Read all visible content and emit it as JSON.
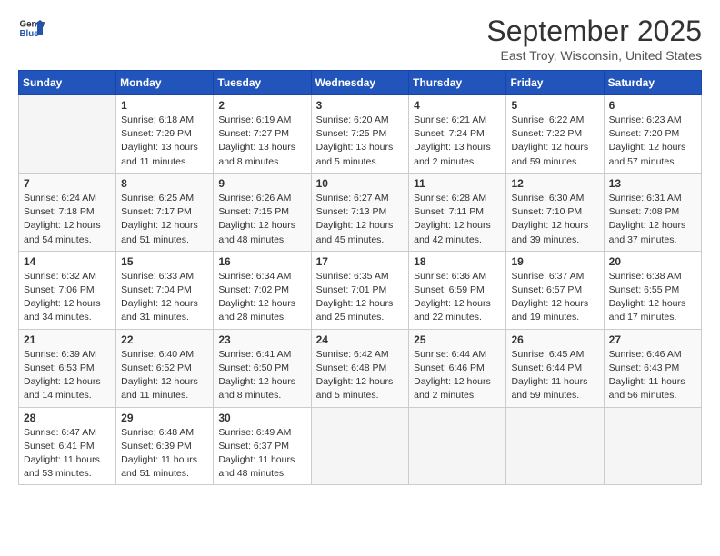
{
  "header": {
    "logo_general": "General",
    "logo_blue": "Blue",
    "month_title": "September 2025",
    "location": "East Troy, Wisconsin, United States"
  },
  "days_of_week": [
    "Sunday",
    "Monday",
    "Tuesday",
    "Wednesday",
    "Thursday",
    "Friday",
    "Saturday"
  ],
  "weeks": [
    [
      {
        "day": "",
        "info": ""
      },
      {
        "day": "1",
        "info": "Sunrise: 6:18 AM\nSunset: 7:29 PM\nDaylight: 13 hours\nand 11 minutes."
      },
      {
        "day": "2",
        "info": "Sunrise: 6:19 AM\nSunset: 7:27 PM\nDaylight: 13 hours\nand 8 minutes."
      },
      {
        "day": "3",
        "info": "Sunrise: 6:20 AM\nSunset: 7:25 PM\nDaylight: 13 hours\nand 5 minutes."
      },
      {
        "day": "4",
        "info": "Sunrise: 6:21 AM\nSunset: 7:24 PM\nDaylight: 13 hours\nand 2 minutes."
      },
      {
        "day": "5",
        "info": "Sunrise: 6:22 AM\nSunset: 7:22 PM\nDaylight: 12 hours\nand 59 minutes."
      },
      {
        "day": "6",
        "info": "Sunrise: 6:23 AM\nSunset: 7:20 PM\nDaylight: 12 hours\nand 57 minutes."
      }
    ],
    [
      {
        "day": "7",
        "info": "Sunrise: 6:24 AM\nSunset: 7:18 PM\nDaylight: 12 hours\nand 54 minutes."
      },
      {
        "day": "8",
        "info": "Sunrise: 6:25 AM\nSunset: 7:17 PM\nDaylight: 12 hours\nand 51 minutes."
      },
      {
        "day": "9",
        "info": "Sunrise: 6:26 AM\nSunset: 7:15 PM\nDaylight: 12 hours\nand 48 minutes."
      },
      {
        "day": "10",
        "info": "Sunrise: 6:27 AM\nSunset: 7:13 PM\nDaylight: 12 hours\nand 45 minutes."
      },
      {
        "day": "11",
        "info": "Sunrise: 6:28 AM\nSunset: 7:11 PM\nDaylight: 12 hours\nand 42 minutes."
      },
      {
        "day": "12",
        "info": "Sunrise: 6:30 AM\nSunset: 7:10 PM\nDaylight: 12 hours\nand 39 minutes."
      },
      {
        "day": "13",
        "info": "Sunrise: 6:31 AM\nSunset: 7:08 PM\nDaylight: 12 hours\nand 37 minutes."
      }
    ],
    [
      {
        "day": "14",
        "info": "Sunrise: 6:32 AM\nSunset: 7:06 PM\nDaylight: 12 hours\nand 34 minutes."
      },
      {
        "day": "15",
        "info": "Sunrise: 6:33 AM\nSunset: 7:04 PM\nDaylight: 12 hours\nand 31 minutes."
      },
      {
        "day": "16",
        "info": "Sunrise: 6:34 AM\nSunset: 7:02 PM\nDaylight: 12 hours\nand 28 minutes."
      },
      {
        "day": "17",
        "info": "Sunrise: 6:35 AM\nSunset: 7:01 PM\nDaylight: 12 hours\nand 25 minutes."
      },
      {
        "day": "18",
        "info": "Sunrise: 6:36 AM\nSunset: 6:59 PM\nDaylight: 12 hours\nand 22 minutes."
      },
      {
        "day": "19",
        "info": "Sunrise: 6:37 AM\nSunset: 6:57 PM\nDaylight: 12 hours\nand 19 minutes."
      },
      {
        "day": "20",
        "info": "Sunrise: 6:38 AM\nSunset: 6:55 PM\nDaylight: 12 hours\nand 17 minutes."
      }
    ],
    [
      {
        "day": "21",
        "info": "Sunrise: 6:39 AM\nSunset: 6:53 PM\nDaylight: 12 hours\nand 14 minutes."
      },
      {
        "day": "22",
        "info": "Sunrise: 6:40 AM\nSunset: 6:52 PM\nDaylight: 12 hours\nand 11 minutes."
      },
      {
        "day": "23",
        "info": "Sunrise: 6:41 AM\nSunset: 6:50 PM\nDaylight: 12 hours\nand 8 minutes."
      },
      {
        "day": "24",
        "info": "Sunrise: 6:42 AM\nSunset: 6:48 PM\nDaylight: 12 hours\nand 5 minutes."
      },
      {
        "day": "25",
        "info": "Sunrise: 6:44 AM\nSunset: 6:46 PM\nDaylight: 12 hours\nand 2 minutes."
      },
      {
        "day": "26",
        "info": "Sunrise: 6:45 AM\nSunset: 6:44 PM\nDaylight: 11 hours\nand 59 minutes."
      },
      {
        "day": "27",
        "info": "Sunrise: 6:46 AM\nSunset: 6:43 PM\nDaylight: 11 hours\nand 56 minutes."
      }
    ],
    [
      {
        "day": "28",
        "info": "Sunrise: 6:47 AM\nSunset: 6:41 PM\nDaylight: 11 hours\nand 53 minutes."
      },
      {
        "day": "29",
        "info": "Sunrise: 6:48 AM\nSunset: 6:39 PM\nDaylight: 11 hours\nand 51 minutes."
      },
      {
        "day": "30",
        "info": "Sunrise: 6:49 AM\nSunset: 6:37 PM\nDaylight: 11 hours\nand 48 minutes."
      },
      {
        "day": "",
        "info": ""
      },
      {
        "day": "",
        "info": ""
      },
      {
        "day": "",
        "info": ""
      },
      {
        "day": "",
        "info": ""
      }
    ]
  ]
}
